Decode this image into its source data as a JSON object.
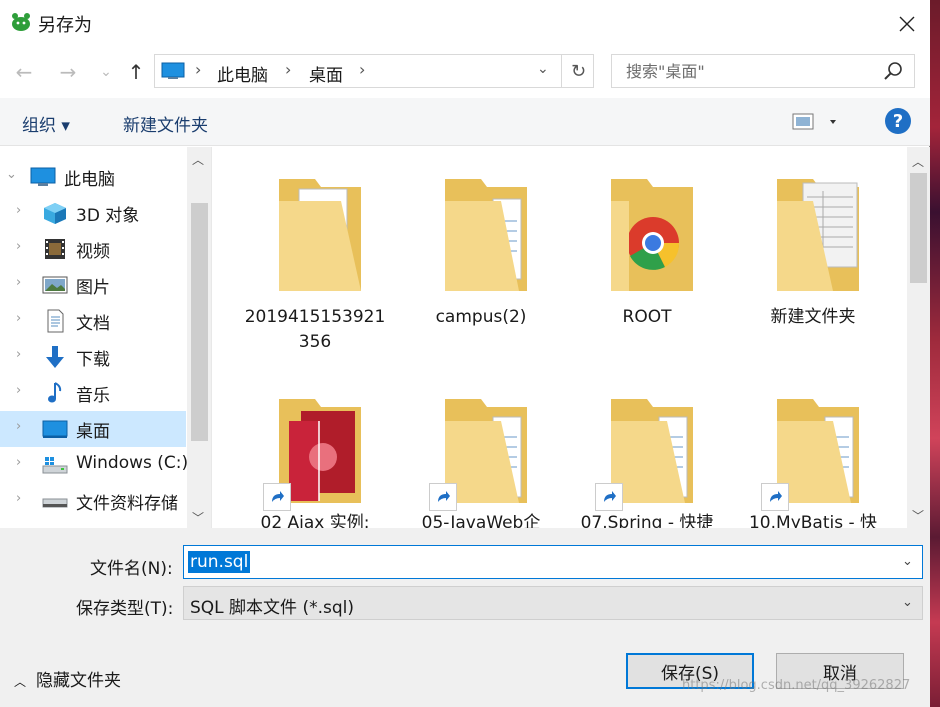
{
  "window": {
    "title": "另存为"
  },
  "nav": {
    "back": "←",
    "forward": "→",
    "recent": "⌄",
    "up": "↑",
    "breadcrumbs": [
      "此电脑",
      "桌面"
    ],
    "search_placeholder": "搜索\"桌面\""
  },
  "toolbar": {
    "organize": "组织 ▾",
    "new_folder": "新建文件夹",
    "help": "?"
  },
  "sidebar": {
    "items": [
      {
        "label": "此电脑",
        "icon": "pc-icon"
      },
      {
        "label": "3D 对象",
        "icon": "3d-objects-icon"
      },
      {
        "label": "视频",
        "icon": "video-icon"
      },
      {
        "label": "图片",
        "icon": "pictures-icon"
      },
      {
        "label": "文档",
        "icon": "documents-icon"
      },
      {
        "label": "下载",
        "icon": "download-icon"
      },
      {
        "label": "音乐",
        "icon": "music-icon"
      },
      {
        "label": "桌面",
        "icon": "desktop-icon"
      },
      {
        "label": "Windows (C:)",
        "icon": "windows-drive-icon"
      },
      {
        "label": "文件资料存储",
        "icon": "drive-icon"
      }
    ],
    "selected": "桌面"
  },
  "files": [
    {
      "name": "2019415153921\n356",
      "icon": "folder-docs-icon"
    },
    {
      "name": "campus(2)",
      "icon": "folder-icon"
    },
    {
      "name": "ROOT",
      "icon": "folder-chrome-icon"
    },
    {
      "name": "新建文件夹",
      "icon": "folder-docs-icon"
    },
    {
      "name": "02 Ajax 实例:",
      "icon": "folder-shortcut-icon"
    },
    {
      "name": "05-JavaWeb企",
      "icon": "folder-shortcut-icon"
    },
    {
      "name": "07.Spring - 快捷",
      "icon": "folder-shortcut-icon"
    },
    {
      "name": "10.MyBatis - 快",
      "icon": "folder-shortcut-icon"
    }
  ],
  "form": {
    "filename_label": "文件名(N):",
    "filename_value": "run.sql",
    "filetype_label": "保存类型(T):",
    "filetype_value": "SQL 脚本文件 (*.sql)",
    "hide_folders": "隐藏文件夹",
    "save": "保存(S)",
    "cancel": "取消"
  },
  "watermark": "https://blog.csdn.net/qq_39262827"
}
